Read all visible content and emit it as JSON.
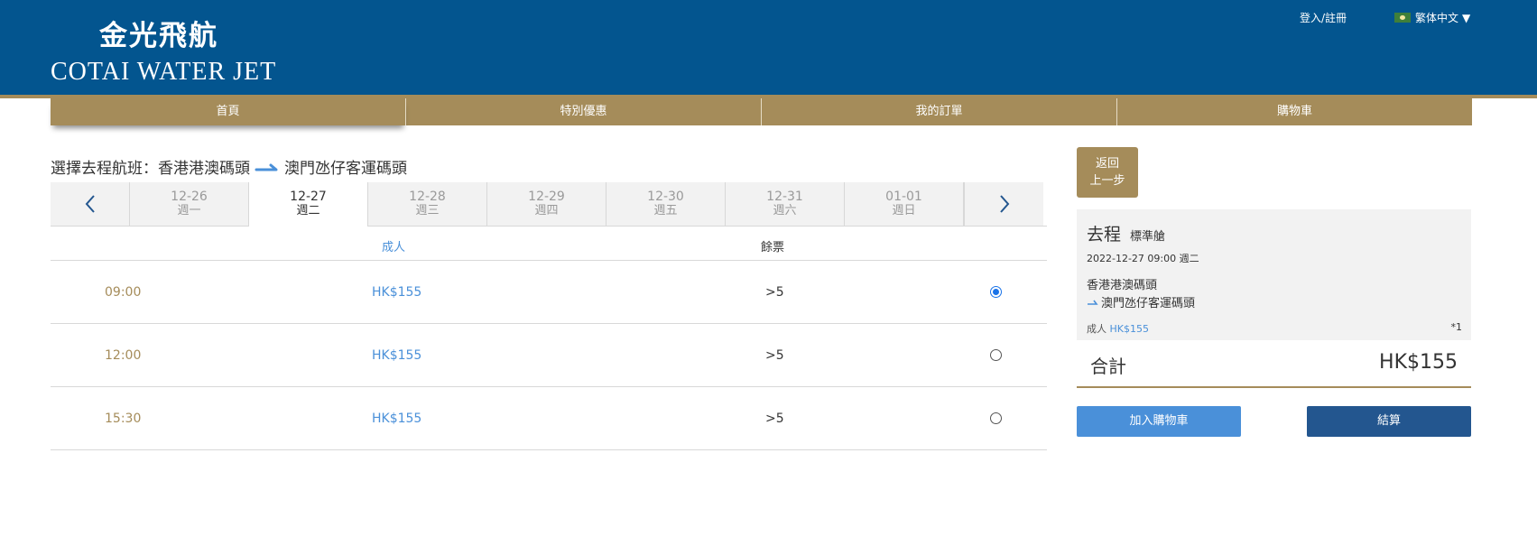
{
  "header": {
    "logo_cn": "金光飛航",
    "logo_en": "COTAI WATER JET",
    "login": "登入/註冊",
    "language": "繁体中文"
  },
  "nav": [
    "首頁",
    "特別優惠",
    "我的訂單",
    "購物車"
  ],
  "route": {
    "prefix": "選擇去程航班：",
    "from": "香港港澳碼頭",
    "to": "澳門氹仔客運碼頭"
  },
  "dates": [
    {
      "date": "12-26",
      "weekday": "週一"
    },
    {
      "date": "12-27",
      "weekday": "週二"
    },
    {
      "date": "12-28",
      "weekday": "週三"
    },
    {
      "date": "12-29",
      "weekday": "週四"
    },
    {
      "date": "12-30",
      "weekday": "週五"
    },
    {
      "date": "12-31",
      "weekday": "週六"
    },
    {
      "date": "01-01",
      "weekday": "週日"
    }
  ],
  "selected_date_index": 1,
  "table": {
    "headers": {
      "adult": "成人",
      "remaining": "餘票"
    },
    "rows": [
      {
        "time": "09:00",
        "price": "HK$155",
        "remaining": ">5",
        "selected": true
      },
      {
        "time": "12:00",
        "price": "HK$155",
        "remaining": ">5",
        "selected": false
      },
      {
        "time": "15:30",
        "price": "HK$155",
        "remaining": ">5",
        "selected": false
      }
    ]
  },
  "back_button": {
    "line1": "返回",
    "line2": "上一步"
  },
  "summary": {
    "title": "去程",
    "class": "標準艙",
    "datetime": "2022-12-27 09:00 週二",
    "from": "香港港澳碼頭",
    "to": "澳門氹仔客運碼頭",
    "pax_label": "成人",
    "pax_price": "HK$155",
    "qty": "*1"
  },
  "total": {
    "label": "合計",
    "value": "HK$155"
  },
  "buttons": {
    "add_cart": "加入購物車",
    "checkout": "結算"
  },
  "colors": {
    "header": "#03558f",
    "gold": "#a58c5a",
    "link": "#4a90d9",
    "checkout": "#23568f"
  }
}
